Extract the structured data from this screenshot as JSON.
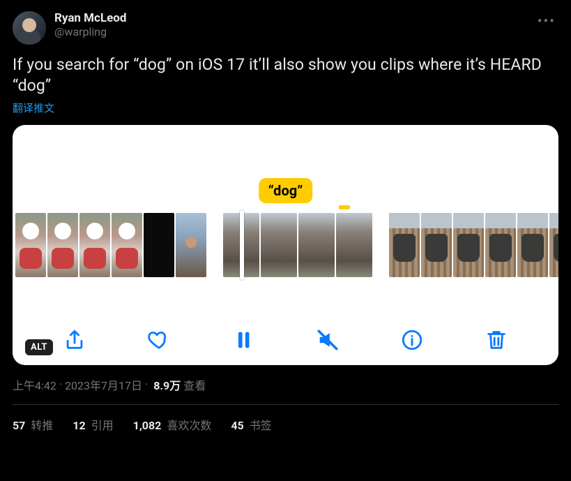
{
  "author": {
    "display_name": "Ryan McLeod",
    "handle": "@warpling"
  },
  "body_text": "If you search for “dog” on iOS 17 it’ll also show you clips where it’s HEARD “dog”",
  "translate_label": "翻译推文",
  "media": {
    "caption_pill": "“dog”",
    "alt_badge": "ALT"
  },
  "meta": {
    "time": "上午4:42",
    "sep1": " · ",
    "date": "2023年7月17日",
    "sep2": " · ",
    "views_number": "8.9万",
    "views_label": " 查看"
  },
  "stats": {
    "retweets": {
      "count": "57",
      "label": " 转推"
    },
    "quotes": {
      "count": "12",
      "label": " 引用"
    },
    "likes": {
      "count": "1,082",
      "label": " 喜欢次数"
    },
    "bookmarks": {
      "count": "45",
      "label": " 书签"
    }
  }
}
